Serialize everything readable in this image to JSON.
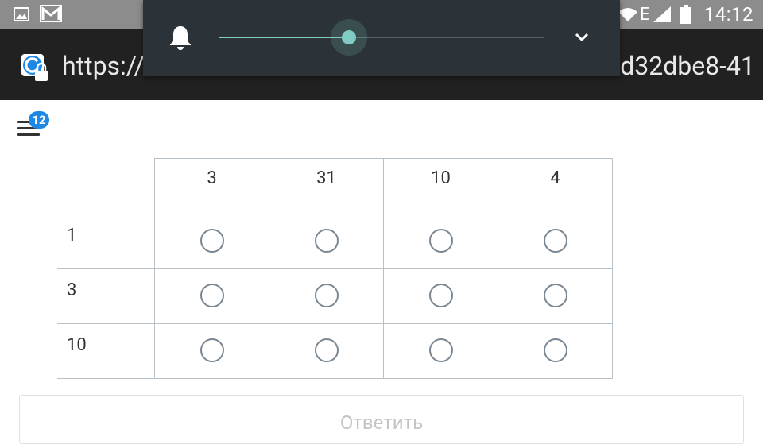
{
  "status_bar": {
    "time": "14:12",
    "network_type": "E",
    "icons": [
      "image-icon",
      "gmail-icon",
      "wifi-icon",
      "signal-icon",
      "battery-icon"
    ]
  },
  "browser": {
    "url_start": "https://",
    "url_end": "d32dbe8-41",
    "site_icon": "secure-site-icon"
  },
  "volume_panel": {
    "level_fraction": 0.4,
    "accent_color": "#80cbc4",
    "icons": [
      "bell-icon",
      "chevron-down-icon"
    ]
  },
  "header": {
    "menu_icon": "hamburger-menu-icon",
    "badge_count": "12",
    "badge_color": "#1e88e5"
  },
  "grid": {
    "columns": [
      "3",
      "31",
      "10",
      "4"
    ],
    "rows": [
      "1",
      "3",
      "10"
    ]
  },
  "submit": {
    "label": "Ответить"
  }
}
